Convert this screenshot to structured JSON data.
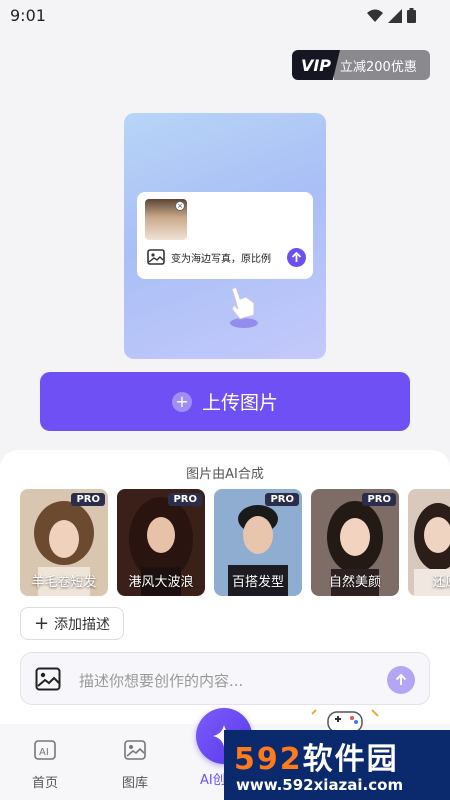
{
  "status": {
    "time": "9:01"
  },
  "vip": {
    "badge": "VIP",
    "promo": "立减200优惠"
  },
  "preview": {
    "prompt": "变为海边写真，原比例"
  },
  "upload": {
    "label": "上传图片"
  },
  "sheet": {
    "title": "图片由AI合成"
  },
  "styles": [
    {
      "label": "羊毛卷短发",
      "badge": "PRO",
      "color": "#b9906f"
    },
    {
      "label": "港风大波浪",
      "badge": "PRO",
      "color": "#5a3024"
    },
    {
      "label": "百搭发型",
      "badge": "PRO",
      "color": "#8aa7c8"
    },
    {
      "label": "自然美颜",
      "badge": "PRO",
      "color": "#9c8a85"
    },
    {
      "label": "还原年",
      "badge": "",
      "color": "#d9c9bc"
    }
  ],
  "add_description": {
    "label": "添加描述"
  },
  "input": {
    "placeholder": "描述你想要创作的内容..."
  },
  "nav": {
    "home": "首页",
    "gallery": "图库",
    "ai": "AI创作"
  },
  "watermark": {
    "brand_num": "592",
    "brand_text": "软件园",
    "url": "www.592xiazai.com"
  },
  "colors": {
    "accent": "#6e50f4",
    "vip_dark": "#161622",
    "watermark_bg": "#0b2a6e",
    "watermark_orange": "#ff7a1a"
  }
}
